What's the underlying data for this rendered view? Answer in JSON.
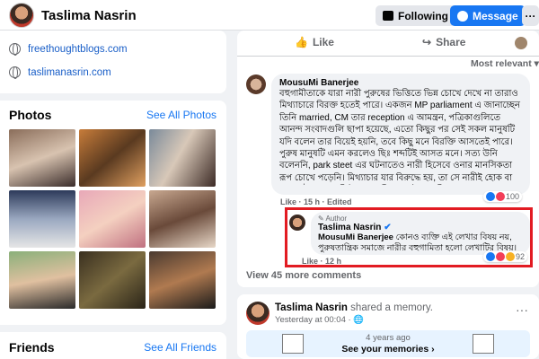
{
  "header": {
    "page_name": "Taslima Nasrin",
    "following_label": "Following",
    "message_label": "Message",
    "more_label": "···"
  },
  "intro": {
    "links": [
      "freethoughtblogs.com",
      "taslimanasrin.com"
    ]
  },
  "photos": {
    "title": "Photos",
    "see_all": "See All Photos"
  },
  "friends": {
    "title": "Friends",
    "see_all": "See All Friends"
  },
  "post": {
    "actions": {
      "like": "Like",
      "share": "Share"
    },
    "sort_label": "Most relevant",
    "comment": {
      "author": "MousuMi Banerjee",
      "text": "বহুগামীতাকে যারা নারী পুরুষের ভিত্তিতে ভিন্ন চোখে দেখে না তারাও মিথ্যাচারে বিরক্ত হতেই পারে। একজন MP parliament এ জানাচ্ছেন তিনি married, CM তার reception এ আমন্ত্রন, পত্রিকাগুলিতে আনন্দ সংবাদগুলি ছাপা হয়েছে, এতো কিছুর পর সেই সকল মানুষটি যদি বলেন তার বিয়েই হয়নি, তবে কিছু মনে বিরক্তি আসতেই পারে। পুরুষ মানুষটি এমন করলেও ছিঃ শব্দটিই আসত মনে। সত্য উনি বলেননি, park steet এর ঘটনাতেও নারী হিসেবে ওনার মানসিকতা রূপ চোখে পড়েনি। মিথ্যাচার যার বিরুদ্ধে হয়, তা সে নারীই হোক বা পুরুষ -উভয়ের প্রতিই সহানুভূতি জাগাই স্বাভাবিক। এক্ষেত্রে অনেক মুক্ত মনের মানুষও বিরক্ত হয়েছেন। তাদের দোষ দেওয়াও যায় না।",
      "time": "15 h",
      "like_label": "Like",
      "edited_label": "Edited",
      "reactions": "100"
    },
    "reply": {
      "badge": "Author",
      "author": "Taslima Nasrin",
      "mention": "MousuMi Banerjee",
      "text": "কোনও ব্যক্তি এই লেখার বিষয় নয়, পুরুষতান্ত্রিক সমাজে নারীর বহুগামিতা হলো লেখাটির বিষয়।",
      "like_label": "Like",
      "time": "12 h",
      "reactions": "92"
    },
    "view_more": "View 45 more comments"
  },
  "memory_post": {
    "author": "Taslima Nasrin",
    "action": "shared a memory.",
    "time": "Yesterday at 00:04",
    "years_ago": "4 years ago",
    "see_memories": "See your memories"
  },
  "colors": {
    "accent": "#1877f2",
    "highlight": "#e21b22"
  }
}
